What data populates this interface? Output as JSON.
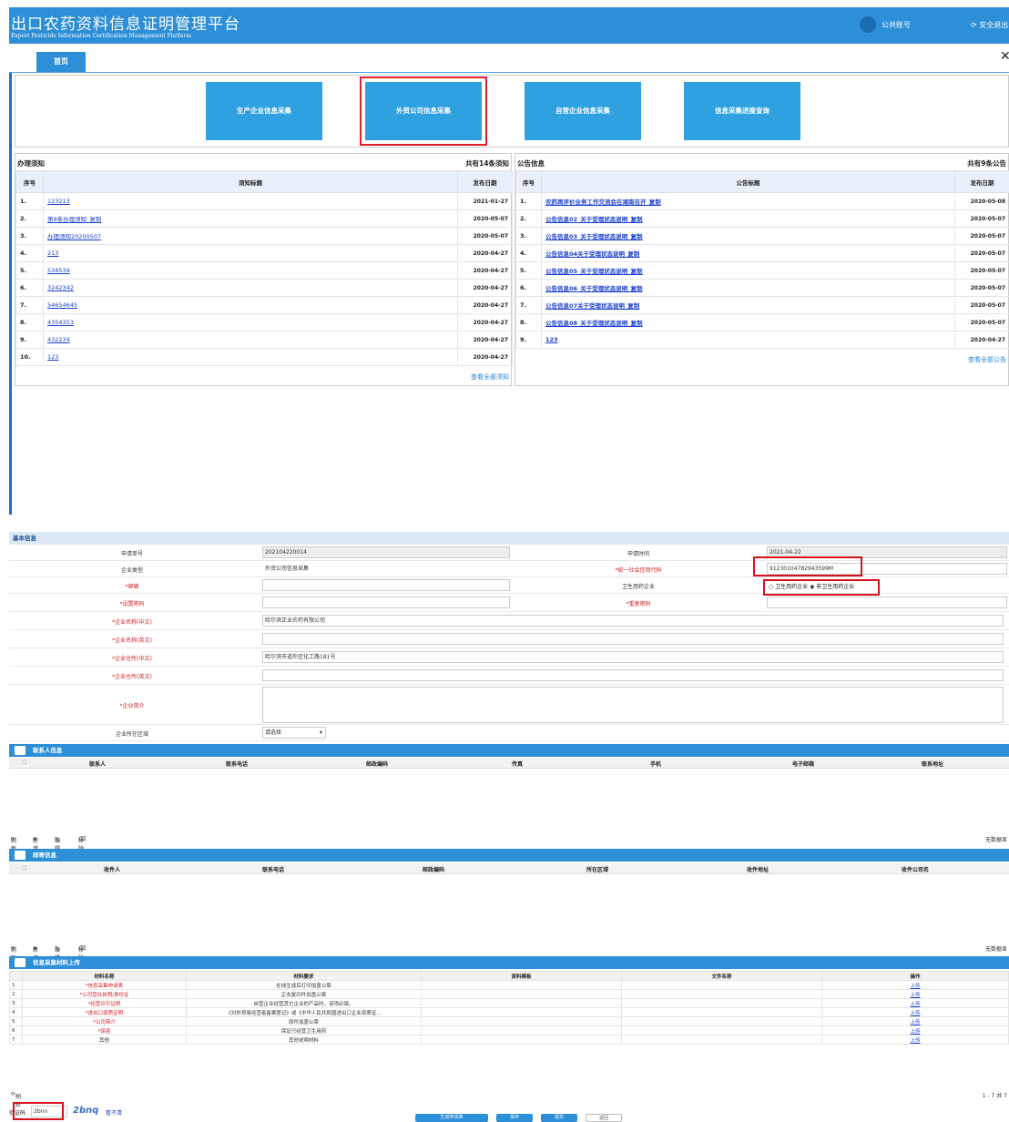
{
  "header": {
    "title": "出口农药资料信息证明管理平台",
    "subtitle": "Export Pesticide Information Certification Management Platform",
    "user_label": "公共账号",
    "logout_label": "安全退出"
  },
  "tabs": {
    "home": "首页",
    "close": "✕"
  },
  "tiles": [
    "生产企业信息采集",
    "外贸公司信息采集",
    "自营企业信息采集",
    "信息采集进度查询"
  ],
  "notices": {
    "title": "办理须知",
    "count": "共有14条须知",
    "col_no": "序号",
    "col_title": "须知标题",
    "col_date": "发布日期",
    "view_all": "查看全部须知",
    "rows": [
      {
        "no": "1.",
        "title": "123213",
        "date": "2021-01-27"
      },
      {
        "no": "2.",
        "title": "第8条办理须知_复制",
        "date": "2020-05-07"
      },
      {
        "no": "3.",
        "title": "办理须知20200507",
        "date": "2020-05-07"
      },
      {
        "no": "4.",
        "title": "213",
        "date": "2020-04-27"
      },
      {
        "no": "5.",
        "title": "534534",
        "date": "2020-04-27"
      },
      {
        "no": "6.",
        "title": "3242342",
        "date": "2020-04-27"
      },
      {
        "no": "7.",
        "title": "54654645",
        "date": "2020-04-27"
      },
      {
        "no": "8.",
        "title": "4354353",
        "date": "2020-04-27"
      },
      {
        "no": "9.",
        "title": "432234",
        "date": "2020-04-27"
      },
      {
        "no": "10.",
        "title": "123",
        "date": "2020-04-27"
      }
    ]
  },
  "announcements": {
    "title": "公告信息",
    "count": "共有9条公告",
    "col_no": "序号",
    "col_title": "公告标题",
    "col_date": "发布日期",
    "view_all": "查看全部公告",
    "rows": [
      {
        "no": "1.",
        "title": "农药再评价业务工作交流会在湘南召开_复制",
        "date": "2020-05-08"
      },
      {
        "no": "2.",
        "title": "公告信息02_关于受理状态说明_复制",
        "date": "2020-05-07"
      },
      {
        "no": "3.",
        "title": "公告信息03_关于受理状态说明_复制",
        "date": "2020-05-07"
      },
      {
        "no": "4.",
        "title": "公告信息04关于受理状态说明_复制",
        "date": "2020-05-07"
      },
      {
        "no": "5.",
        "title": "公告信息05_关于受理状态说明_复制",
        "date": "2020-05-07"
      },
      {
        "no": "6.",
        "title": "公告信息06_关于受理状态说明_复制",
        "date": "2020-05-07"
      },
      {
        "no": "7.",
        "title": "公告信息07关于受理状态说明_复制",
        "date": "2020-05-07"
      },
      {
        "no": "8.",
        "title": "公告信息08_关于受理状态说明_复制",
        "date": "2020-05-07"
      },
      {
        "no": "9.",
        "title": "123",
        "date": "2020-04-27"
      }
    ]
  },
  "form": {
    "section": "基本信息",
    "apply_no_label": "申请单号",
    "apply_no": "202104220014",
    "apply_time_label": "申请时间",
    "apply_time": "2021-04-22",
    "company_type_label": "企业类型",
    "company_type": "外贸公司信息采集",
    "credit_code_label": "*统一社会信用代码",
    "credit_code": "91230104782943599M",
    "email_label": "*邮箱",
    "health_label": "卫生用药企业",
    "health_opt1": "卫生用药企业",
    "health_opt2": "非卫生用药企业",
    "password_label": "*设置密码",
    "repeat_password_label": "*重复密码",
    "name_cn_label": "*企业名称(中文)",
    "name_cn": "哈尔滨正业农药有限公司",
    "name_en_label": "*企业名称(英文)",
    "addr_cn_label": "*企业住所(中文)",
    "addr_cn": "哈尔滨市道外区化工路181号",
    "addr_en_label": "*企业住所(英文)",
    "intro_label": "*企业简介",
    "region_label": "企业所在区域",
    "region_value": "请选择"
  },
  "contacts": {
    "title": "联系人信息",
    "cols": [
      "联系人",
      "联系电话",
      "邮政编码",
      "传真",
      "手机",
      "电子邮箱",
      "联系地址"
    ],
    "toolbar": [
      "刷新",
      "新增",
      "编辑",
      "移除"
    ],
    "empty": "无数据显"
  },
  "mailing": {
    "title": "邮寄信息",
    "cols": [
      "收件人",
      "联系电话",
      "邮政编码",
      "所在区域",
      "收件地址",
      "收件公司名"
    ],
    "toolbar": [
      "刷新",
      "新增",
      "编辑",
      "移除"
    ],
    "empty": "无数据显"
  },
  "materials": {
    "title": "信息采集材料上传",
    "cols": [
      "材料名称",
      "材料要求",
      "资料模板",
      "文件名称",
      "操作"
    ],
    "rows": [
      {
        "no": "1",
        "name": "*信息采集申请表",
        "req": "在线生成后打印加盖公章",
        "op": "上传"
      },
      {
        "no": "2",
        "name": "*公司营业执照/身份证",
        "req": "正本复印件加盖公章",
        "op": "上传"
      },
      {
        "no": "3",
        "name": "*经营许可证明",
        "req": "自营企业经营其它企业的产品时，该项必填。",
        "op": "上传"
      },
      {
        "no": "4",
        "name": "*进出口资质证明",
        "req": "《对外贸易经营者备案登记》或《中华人民共和国进出口企业资质证...",
        "op": "上传"
      },
      {
        "no": "5",
        "name": "*公司简介",
        "req": "原件加盖公章",
        "op": "上传"
      },
      {
        "no": "6",
        "name": "*保函",
        "req": "保证只经营卫生用药",
        "op": "上传"
      },
      {
        "no": "7",
        "name": "其他",
        "req": "其他说明材料",
        "op": "上传"
      }
    ],
    "refresh": "刷新",
    "pager": "1 - 7  共 7"
  },
  "captcha": {
    "label": "验证码",
    "value": "2bnn",
    "image_text": "2bnq",
    "unclear": "看不清"
  },
  "buttons": [
    "生成申请表",
    "保存",
    "提交",
    "返回"
  ]
}
